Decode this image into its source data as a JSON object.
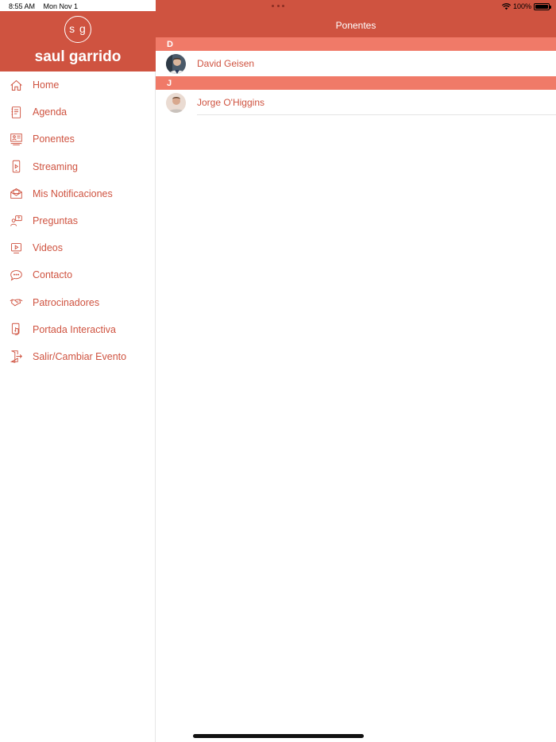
{
  "status_bar": {
    "time": "8:55 AM",
    "date": "Mon Nov 1",
    "battery": "100%"
  },
  "profile": {
    "initials": "s g",
    "name": "saul garrido"
  },
  "menu": [
    {
      "label": "Home",
      "icon": "home-icon"
    },
    {
      "label": "Agenda",
      "icon": "notebook-icon"
    },
    {
      "label": "Ponentes",
      "icon": "speakers-icon"
    },
    {
      "label": "Streaming",
      "icon": "phone-stream-icon"
    },
    {
      "label": "Mis Notificaciones",
      "icon": "mail-icon"
    },
    {
      "label": "Preguntas",
      "icon": "question-icon"
    },
    {
      "label": "Videos",
      "icon": "video-icon"
    },
    {
      "label": "Contacto",
      "icon": "chat-icon"
    },
    {
      "label": "Patrocinadores",
      "icon": "handshake-icon"
    },
    {
      "label": "Portada Interactiva",
      "icon": "touch-phone-icon"
    },
    {
      "label": "Salir/Cambiar Evento",
      "icon": "exit-door-icon"
    }
  ],
  "main": {
    "title": "Ponentes",
    "sections": [
      {
        "letter": "D",
        "items": [
          {
            "name": "David Geisen"
          }
        ]
      },
      {
        "letter": "J",
        "items": [
          {
            "name": "Jorge O'Higgins"
          }
        ]
      }
    ]
  },
  "colors": {
    "brand": "#cf5340",
    "section": "#f07a68"
  }
}
